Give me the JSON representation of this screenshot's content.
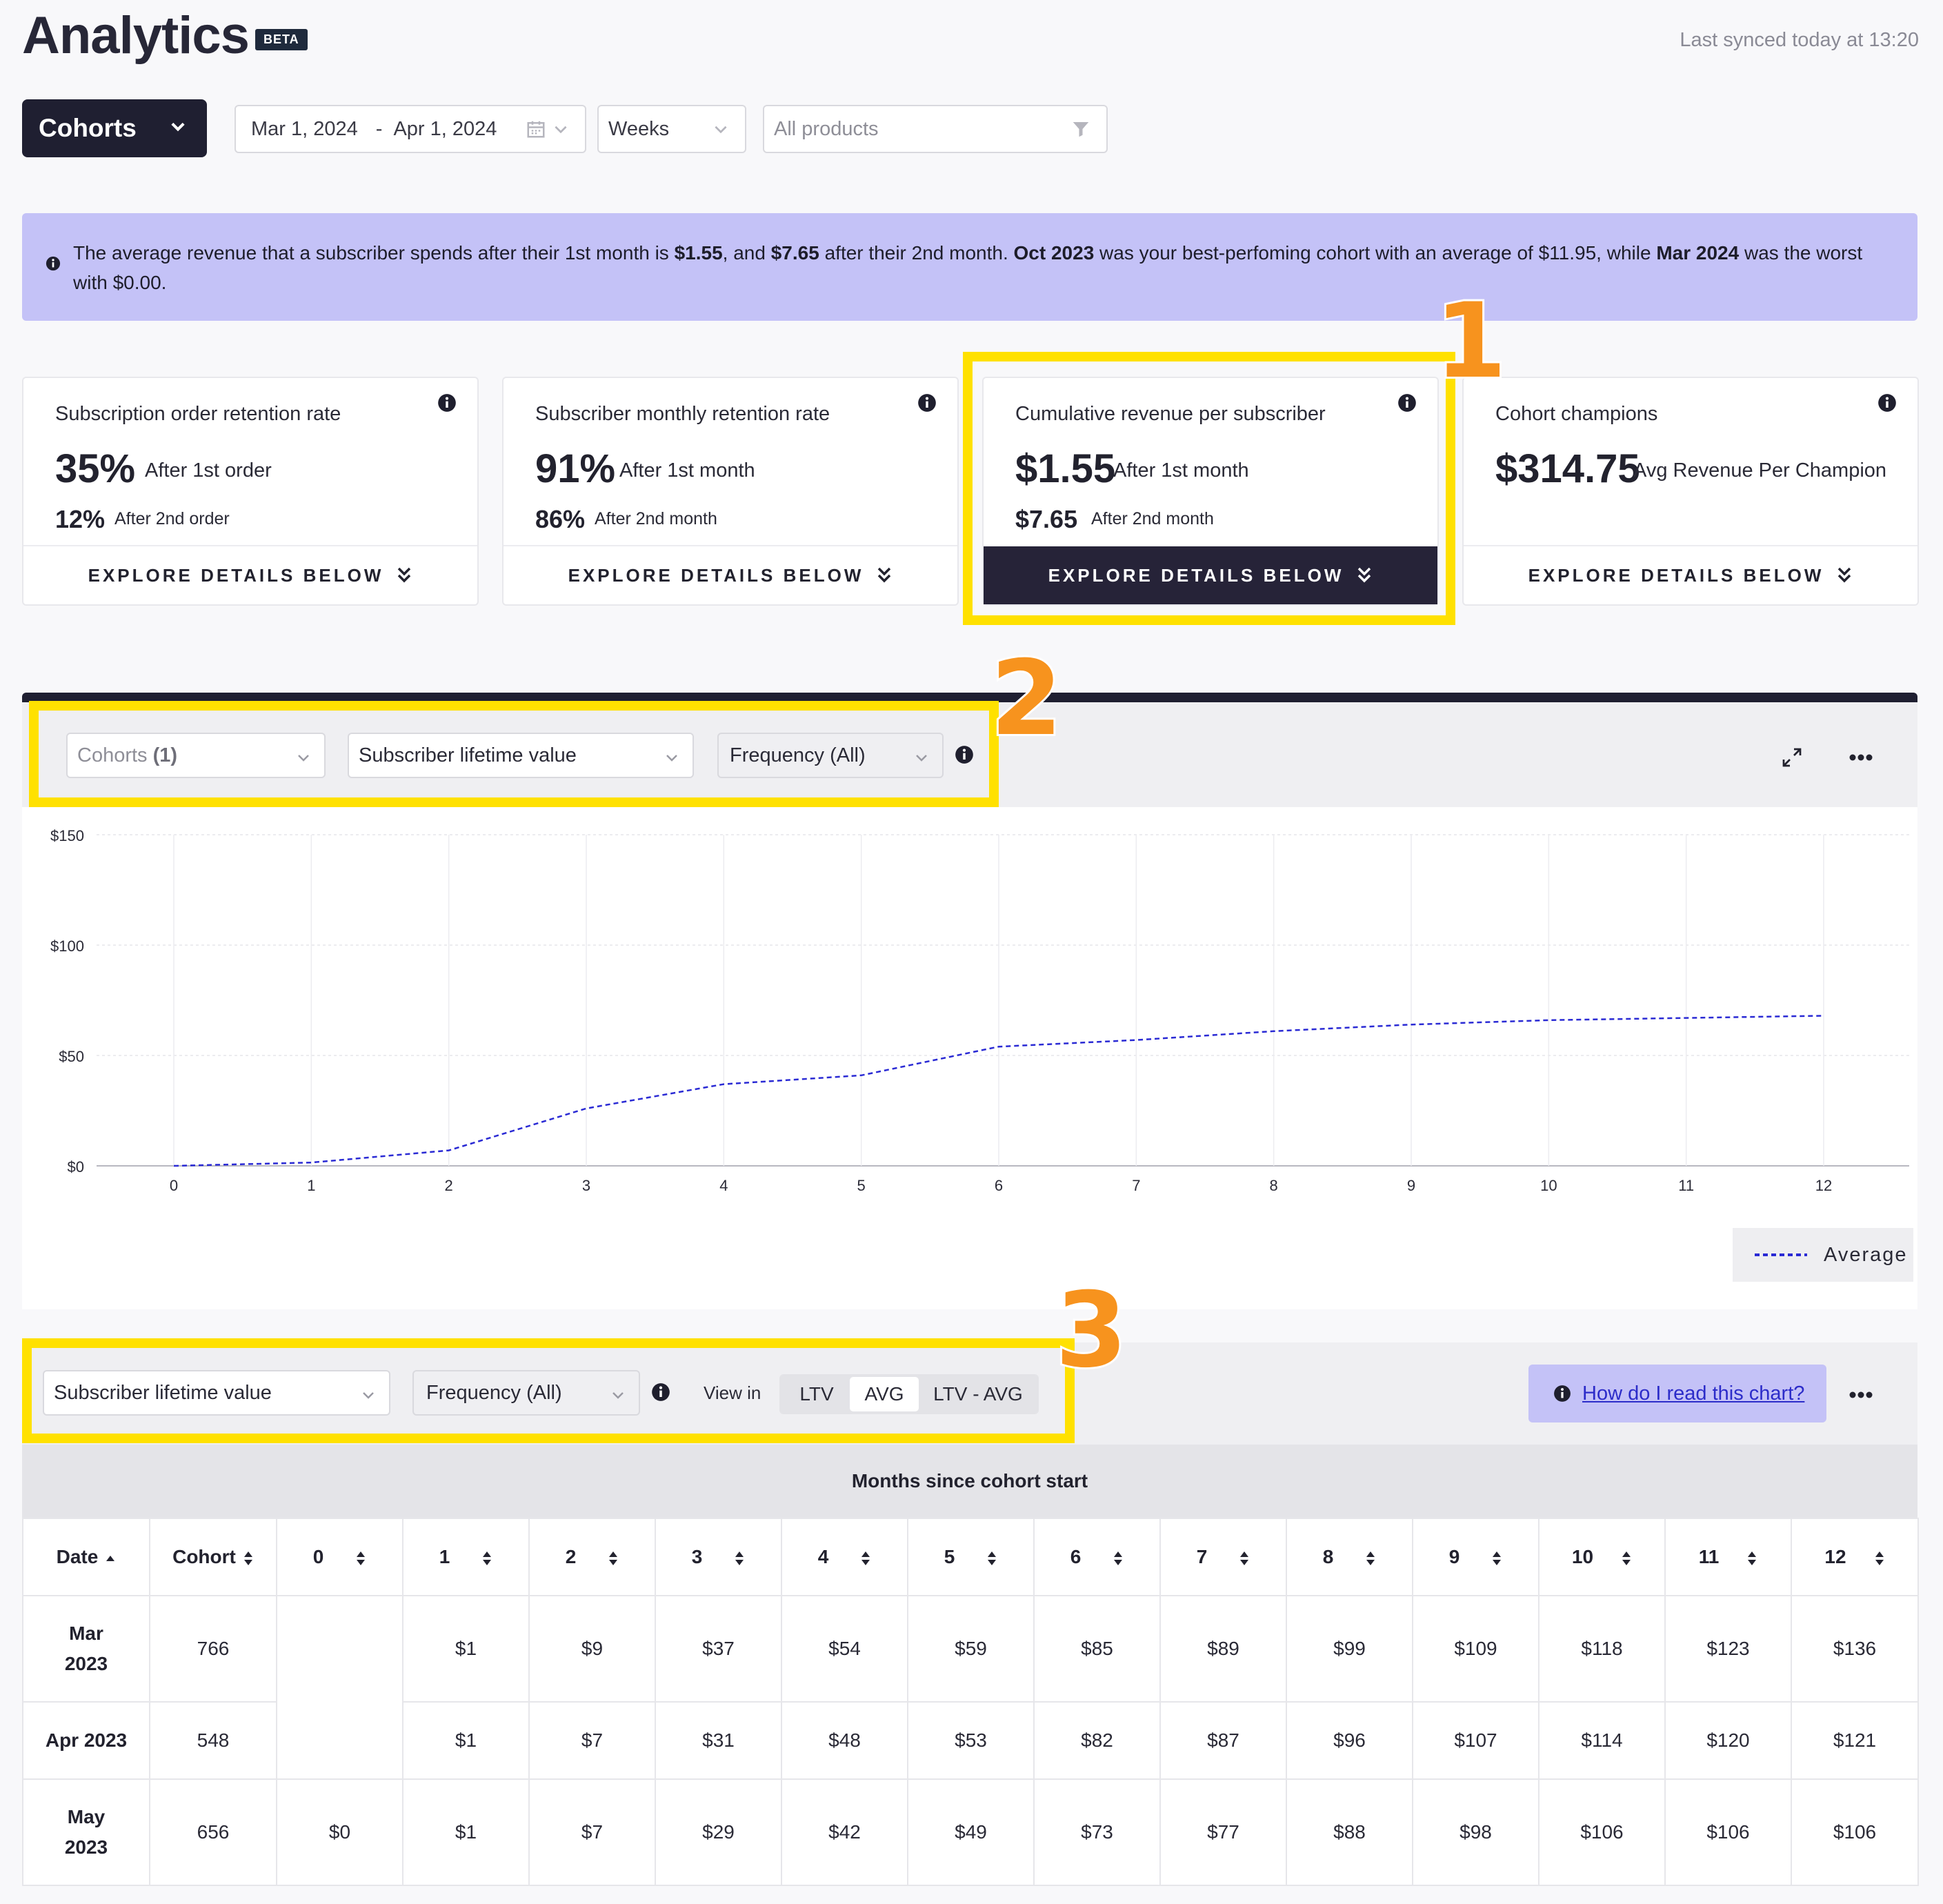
{
  "header": {
    "title": "Analytics",
    "badge": "BETA",
    "synced": "Last synced today at 13:20"
  },
  "filters": {
    "view": "Cohorts",
    "date_from": "Mar 1, 2024",
    "date_sep": "-",
    "date_to": "Apr 1, 2024",
    "granularity": "Weeks",
    "products_placeholder": "All products"
  },
  "banner": {
    "p1": "The average revenue that a subscriber spends after their 1st month is ",
    "b1": "$1.55",
    "p2": ", and ",
    "b2": "$7.65",
    "p3": " after their 2nd month. ",
    "b3": "Oct 2023",
    "p4": " was your best-perfoming cohort with an average of $11.95, while ",
    "b4": "Mar 2024",
    "p5": " was the worst with $0.00."
  },
  "cards": [
    {
      "title": "Subscription order retention rate",
      "big": "35%",
      "big_sub": "After 1st order",
      "mid": "12%",
      "mid_sub": "After 2nd order",
      "cta": "EXPLORE DETAILS BELOW"
    },
    {
      "title": "Subscriber monthly retention rate",
      "big": "91%",
      "big_sub": "After 1st month",
      "mid": "86%",
      "mid_sub": "After 2nd month",
      "cta": "EXPLORE DETAILS BELOW"
    },
    {
      "title": "Cumulative revenue per subscriber",
      "big": "$1.55",
      "big_sub": "After 1st month",
      "mid": "$7.65",
      "mid_sub": "After 2nd month",
      "cta": "EXPLORE DETAILS BELOW"
    },
    {
      "title": "Cohort champions",
      "big": "$314.75",
      "big_sub": "Avg Revenue Per Champion",
      "cta": "EXPLORE DETAILS BELOW"
    }
  ],
  "annotations": {
    "n1": "1",
    "n2": "2",
    "n3": "3"
  },
  "chart_controls": {
    "cohorts": "Cohorts",
    "cohorts_count": "(1)",
    "metric": "Subscriber lifetime value",
    "frequency": "Frequency (All)"
  },
  "chart_data": {
    "type": "line",
    "x": [
      0,
      1,
      2,
      3,
      4,
      5,
      6,
      7,
      8,
      9,
      10,
      11,
      12
    ],
    "series": [
      {
        "name": "Average",
        "values": [
          0,
          1.5,
          7,
          26,
          37,
          41,
          54,
          57,
          61,
          64,
          66,
          67,
          68
        ],
        "color": "#2a2ad4",
        "style": "dashed"
      }
    ],
    "y_ticks": [
      "$0",
      "$50",
      "$100",
      "$150"
    ],
    "x_ticks": [
      "0",
      "1",
      "2",
      "3",
      "4",
      "5",
      "6",
      "7",
      "8",
      "9",
      "10",
      "11",
      "12"
    ],
    "ylim": [
      0,
      150
    ],
    "xlim": [
      0,
      12
    ],
    "grid": true,
    "legend_position": "bottom-right"
  },
  "table_controls": {
    "metric": "Subscriber lifetime value",
    "frequency": "Frequency (All)",
    "view_in": "View in",
    "toggle": [
      "LTV",
      "AVG",
      "LTV - AVG"
    ],
    "toggle_active": "AVG",
    "help_link": "How do I read this chart?"
  },
  "table": {
    "group_header": "Months since cohort start",
    "columns": [
      "Date",
      "Cohort",
      "0",
      "1",
      "2",
      "3",
      "4",
      "5",
      "6",
      "7",
      "8",
      "9",
      "10",
      "11",
      "12"
    ],
    "rows": [
      {
        "date_l1": "Mar",
        "date_l2": "2023",
        "cohort": "766",
        "values": [
          "",
          "$1",
          "$9",
          "$37",
          "$54",
          "$59",
          "$85",
          "$89",
          "$99",
          "$109",
          "$118",
          "$123",
          "$136"
        ]
      },
      {
        "date_l1": "Apr 2023",
        "date_l2": "",
        "cohort": "548",
        "values": [
          "",
          "$1",
          "$7",
          "$31",
          "$48",
          "$53",
          "$82",
          "$87",
          "$96",
          "$107",
          "$114",
          "$120",
          "$121"
        ]
      },
      {
        "date_l1": "May",
        "date_l2": "2023",
        "cohort": "656",
        "values": [
          "$0",
          "$1",
          "$7",
          "$29",
          "$42",
          "$49",
          "$73",
          "$77",
          "$88",
          "$98",
          "$106",
          "$106",
          "$106"
        ]
      }
    ]
  }
}
